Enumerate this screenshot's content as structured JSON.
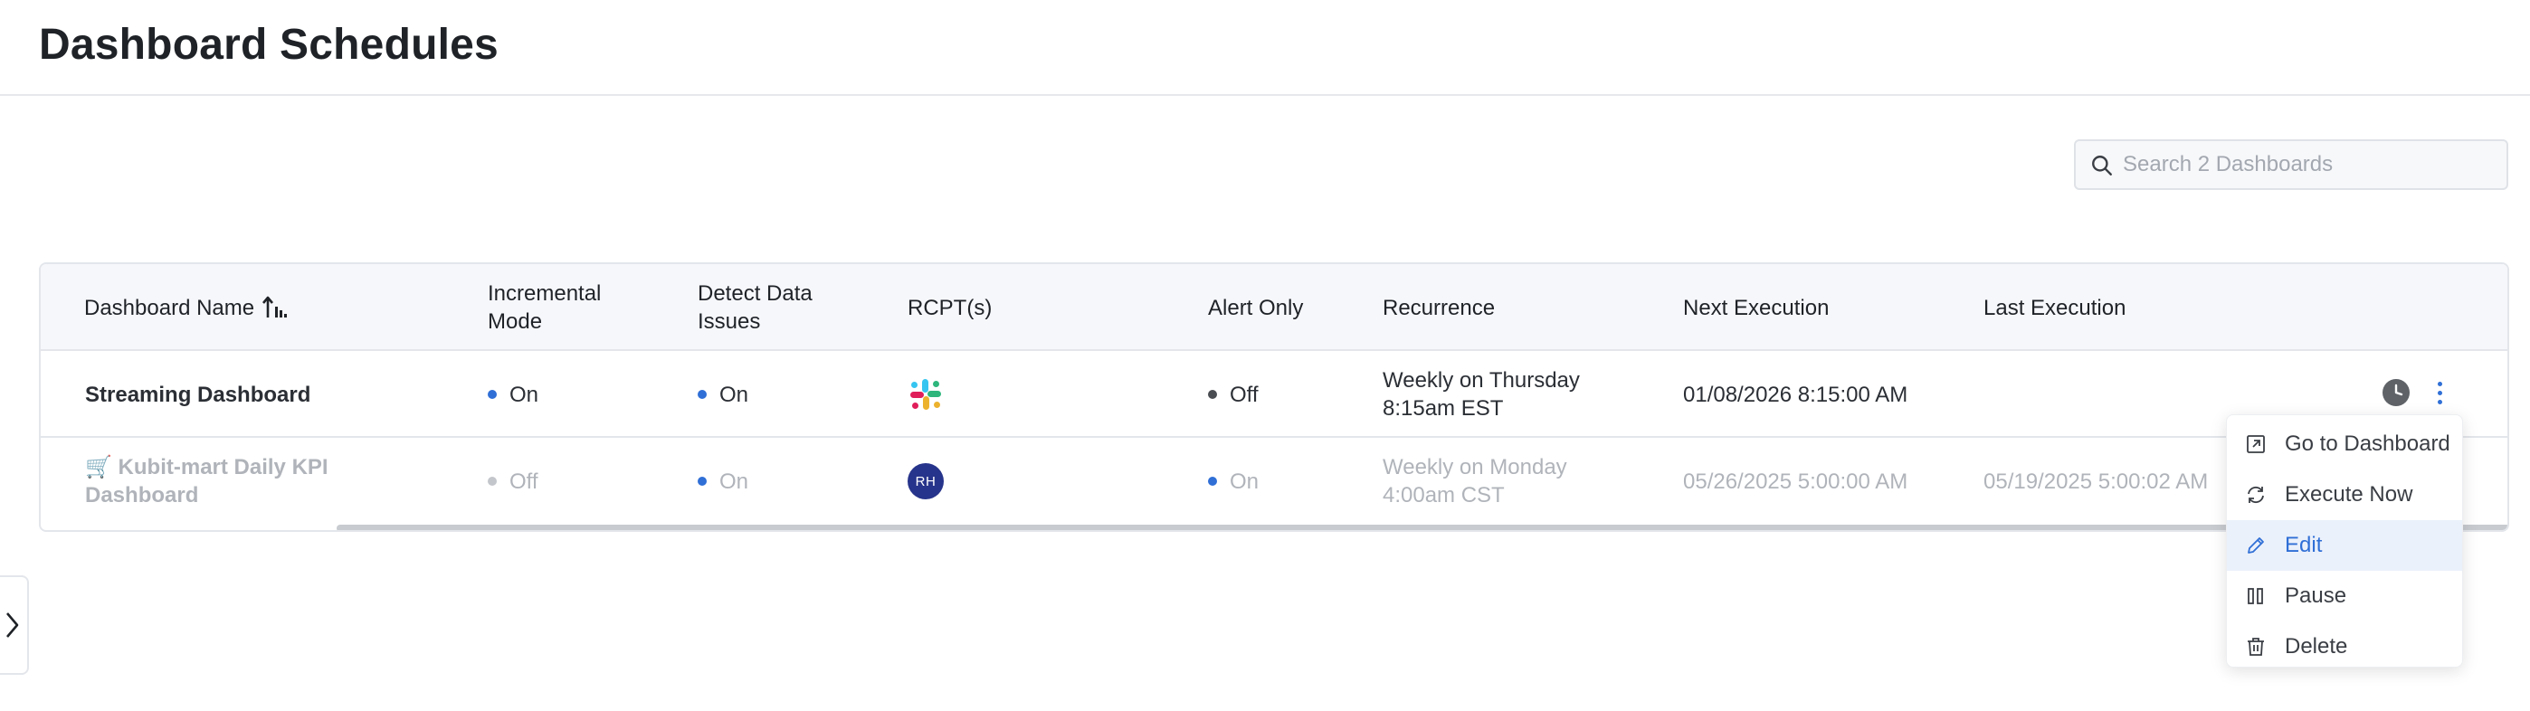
{
  "page": {
    "title": "Dashboard Schedules"
  },
  "search": {
    "placeholder": "Search 2 Dashboards",
    "value": ""
  },
  "table": {
    "headers": {
      "name": "Dashboard Name",
      "incremental_1": "Incremental",
      "incremental_2": "Mode",
      "detect_1": "Detect Data",
      "detect_2": "Issues",
      "rcpt": "RCPT(s)",
      "alert_only": "Alert Only",
      "recurrence": "Recurrence",
      "next_execution": "Next Execution",
      "last_execution": "Last Execution"
    },
    "rows": [
      {
        "name": "Streaming Dashboard",
        "incremental": "On",
        "detect": "On",
        "rcpt_icon": "slack-icon",
        "alert_only": "Off",
        "recurrence_1": "Weekly on Thursday",
        "recurrence_2": "8:15am EST",
        "next_execution": "01/08/2026 8:15:00 AM",
        "last_execution": ""
      },
      {
        "name_1": "🛒 Kubit-mart Daily KPI",
        "name_2": "Dashboard",
        "incremental": "Off",
        "detect": "On",
        "rcpt_avatar": "RH",
        "alert_only": "On",
        "recurrence_1": "Weekly on Monday",
        "recurrence_2": "4:00am CST",
        "next_execution": "05/26/2025 5:00:00 AM",
        "last_execution": "05/19/2025 5:00:02 AM"
      }
    ]
  },
  "menu": {
    "items": [
      {
        "label": "Go to Dashboard",
        "icon": "external-link-icon"
      },
      {
        "label": "Execute Now",
        "icon": "refresh-icon"
      },
      {
        "label": "Edit",
        "icon": "pencil-icon"
      },
      {
        "label": "Pause",
        "icon": "pause-icon"
      },
      {
        "label": "Delete",
        "icon": "trash-icon"
      }
    ]
  },
  "colors": {
    "accent": "#2f6fd6",
    "status_on": "#2f6fd6",
    "status_off": "#4a4d52",
    "avatar_bg": "#27348b"
  }
}
